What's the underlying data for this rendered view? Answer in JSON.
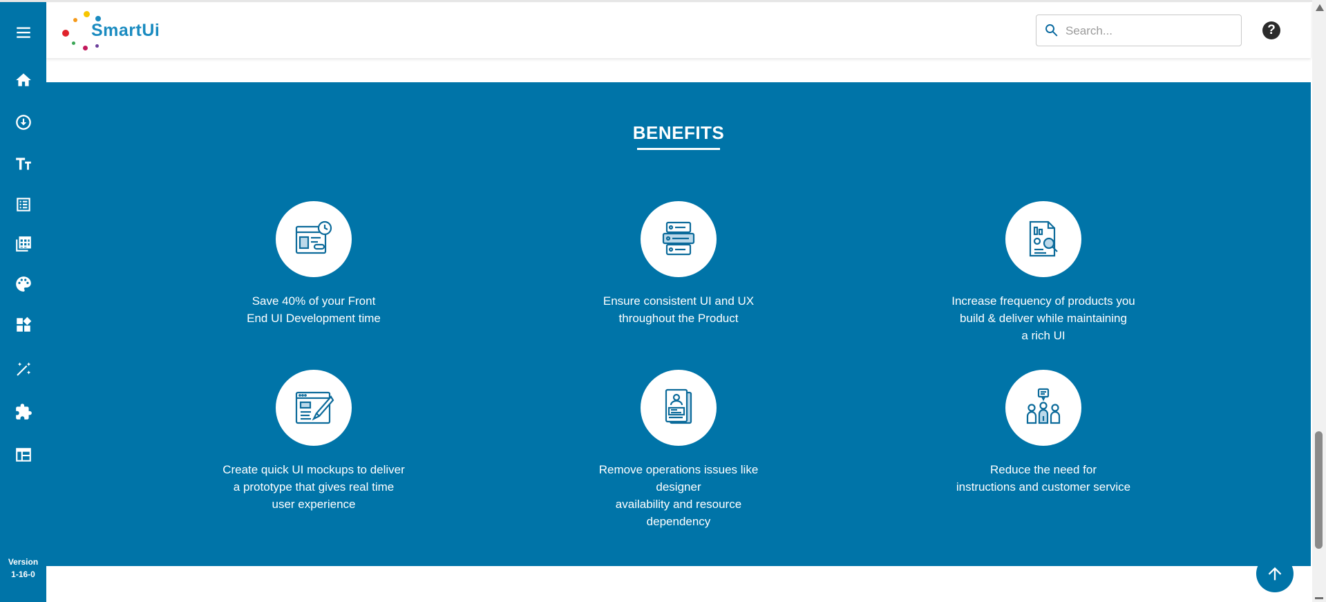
{
  "app": {
    "logo_text": "SmartUi",
    "version_label": "Version",
    "version_number": "1-16-0"
  },
  "header": {
    "search": {
      "placeholder": "Search..."
    },
    "help_label": "?"
  },
  "sidebar": {
    "items": [
      {
        "icon": "menu-icon"
      },
      {
        "icon": "home-icon"
      },
      {
        "icon": "download-circle-icon"
      },
      {
        "icon": "typography-icon"
      },
      {
        "icon": "list-document-icon"
      },
      {
        "icon": "grid-table-icon"
      },
      {
        "icon": "palette-icon"
      },
      {
        "icon": "dashboard-icon"
      },
      {
        "icon": "magic-wand-icon"
      },
      {
        "icon": "puzzle-icon"
      },
      {
        "icon": "layout-icon"
      }
    ]
  },
  "benefits": {
    "title": "BENEFITS",
    "items": [
      {
        "icon": "browser-clock-icon",
        "lines": [
          "Save 40% of your Front",
          "End UI Development time"
        ]
      },
      {
        "icon": "server-stack-icon",
        "lines": [
          "Ensure consistent UI and UX",
          "throughout the Product"
        ]
      },
      {
        "icon": "report-search-icon",
        "lines": [
          "Increase frequency of products you",
          "build & deliver while maintaining",
          "a rich UI"
        ]
      },
      {
        "icon": "design-mockup-icon",
        "lines": [
          "Create quick UI mockups to deliver",
          "a prototype that gives real time",
          "user experience"
        ]
      },
      {
        "icon": "profile-documents-icon",
        "lines": [
          "Remove operations issues like designer",
          "availability and resource",
          "dependency"
        ]
      },
      {
        "icon": "team-communication-icon",
        "lines": [
          "Reduce the need for",
          "instructions and customer service"
        ]
      }
    ]
  },
  "colors": {
    "primary": "#0074a8",
    "logo_blue": "#1a8bc0",
    "white": "#ffffff"
  }
}
